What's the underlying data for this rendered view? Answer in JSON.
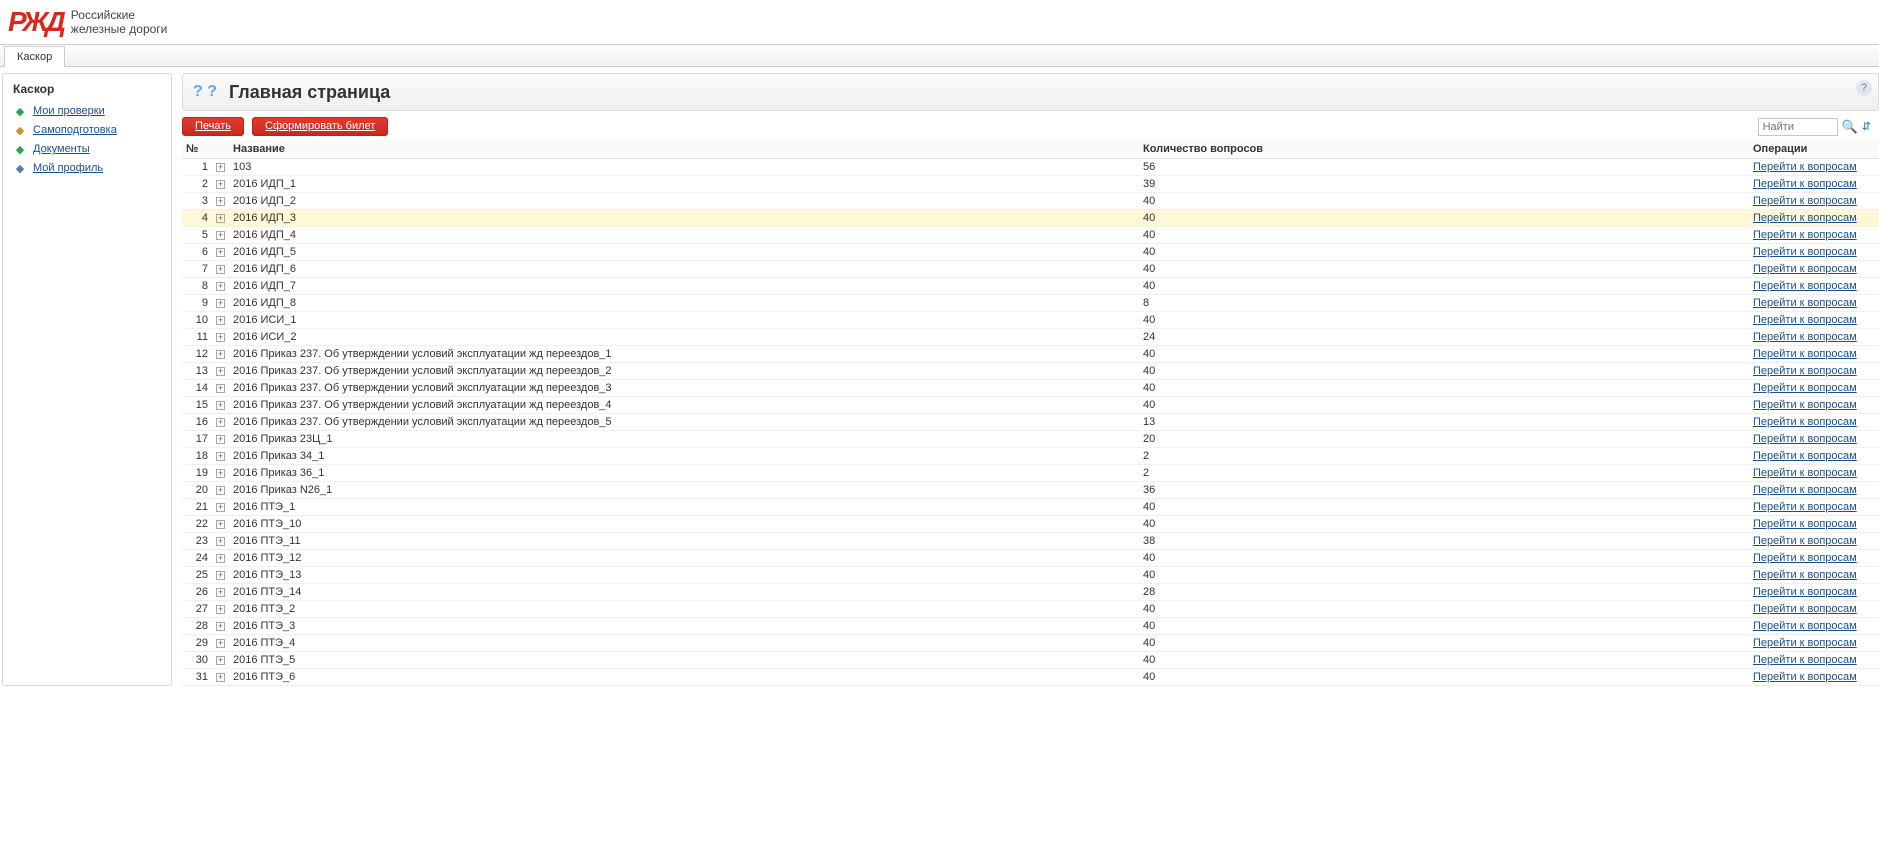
{
  "brand": {
    "line1": "Российские",
    "line2": "железные дороги"
  },
  "tab": "Каскор",
  "sidebar": {
    "title": "Каскор",
    "items": [
      {
        "label": "Мои проверки",
        "iconColor": "#2ea44f"
      },
      {
        "label": "Самоподготовка",
        "iconColor": "#d58a2b"
      },
      {
        "label": "Документы",
        "iconColor": "#2ea44f"
      },
      {
        "label": "Мой профиль",
        "iconColor": "#5a7fa6"
      }
    ]
  },
  "page": {
    "title": "Главная страница"
  },
  "toolbar": {
    "print": "Печать",
    "form": "Сформировать билет"
  },
  "search": {
    "placeholder": "Найти"
  },
  "table": {
    "headers": {
      "num": "№",
      "name": "Название",
      "qty": "Количество вопросов",
      "ops": "Операции"
    },
    "opLink": "Перейти к вопросам",
    "highlightIndex": 3,
    "rows": [
      {
        "n": 1,
        "name": "103",
        "qty": 56
      },
      {
        "n": 2,
        "name": "2016 ИДП_1",
        "qty": 39
      },
      {
        "n": 3,
        "name": "2016 ИДП_2",
        "qty": 40
      },
      {
        "n": 4,
        "name": "2016 ИДП_3",
        "qty": 40
      },
      {
        "n": 5,
        "name": "2016 ИДП_4",
        "qty": 40
      },
      {
        "n": 6,
        "name": "2016 ИДП_5",
        "qty": 40
      },
      {
        "n": 7,
        "name": "2016 ИДП_6",
        "qty": 40
      },
      {
        "n": 8,
        "name": "2016 ИДП_7",
        "qty": 40
      },
      {
        "n": 9,
        "name": "2016 ИДП_8",
        "qty": 8
      },
      {
        "n": 10,
        "name": "2016 ИСИ_1",
        "qty": 40
      },
      {
        "n": 11,
        "name": "2016 ИСИ_2",
        "qty": 24
      },
      {
        "n": 12,
        "name": "2016 Приказ 237. Об утверждении условий эксплуатации жд переездов_1",
        "qty": 40
      },
      {
        "n": 13,
        "name": "2016 Приказ 237. Об утверждении условий эксплуатации жд переездов_2",
        "qty": 40
      },
      {
        "n": 14,
        "name": "2016 Приказ 237. Об утверждении условий эксплуатации жд переездов_3",
        "qty": 40
      },
      {
        "n": 15,
        "name": "2016 Приказ 237. Об утверждении условий эксплуатации жд переездов_4",
        "qty": 40
      },
      {
        "n": 16,
        "name": "2016 Приказ 237. Об утверждении условий эксплуатации жд переездов_5",
        "qty": 13
      },
      {
        "n": 17,
        "name": "2016 Приказ 23Ц_1",
        "qty": 20
      },
      {
        "n": 18,
        "name": "2016 Приказ 34_1",
        "qty": 2
      },
      {
        "n": 19,
        "name": "2016 Приказ 36_1",
        "qty": 2
      },
      {
        "n": 20,
        "name": "2016 Приказ N26_1",
        "qty": 36
      },
      {
        "n": 21,
        "name": "2016 ПТЭ_1",
        "qty": 40
      },
      {
        "n": 22,
        "name": "2016 ПТЭ_10",
        "qty": 40
      },
      {
        "n": 23,
        "name": "2016 ПТЭ_11",
        "qty": 38
      },
      {
        "n": 24,
        "name": "2016 ПТЭ_12",
        "qty": 40
      },
      {
        "n": 25,
        "name": "2016 ПТЭ_13",
        "qty": 40
      },
      {
        "n": 26,
        "name": "2016 ПТЭ_14",
        "qty": 28
      },
      {
        "n": 27,
        "name": "2016 ПТЭ_2",
        "qty": 40
      },
      {
        "n": 28,
        "name": "2016 ПТЭ_3",
        "qty": 40
      },
      {
        "n": 29,
        "name": "2016 ПТЭ_4",
        "qty": 40
      },
      {
        "n": 30,
        "name": "2016 ПТЭ_5",
        "qty": 40
      },
      {
        "n": 31,
        "name": "2016 ПТЭ_6",
        "qty": 40
      }
    ]
  }
}
